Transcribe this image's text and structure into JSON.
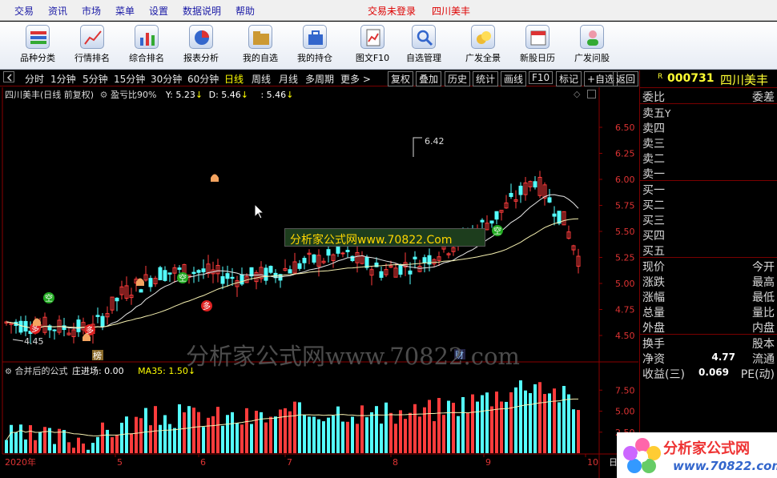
{
  "menu": {
    "items": [
      "交易",
      "资讯",
      "市场",
      "菜单",
      "设置",
      "数据说明",
      "帮助"
    ],
    "status": "交易未登录",
    "stock_name": "四川美丰"
  },
  "toolbar": {
    "buttons": [
      "品种分类",
      "行情排名",
      "综合排名",
      "报表分析",
      "我的自选",
      "我的持仓",
      "图文F10",
      "自选管理",
      "广发全景",
      "新股日历",
      "广发问股"
    ]
  },
  "period_bar": {
    "periods": [
      "分时",
      "1分钟",
      "5分钟",
      "15分钟",
      "30分钟",
      "60分钟",
      "日线",
      "周线",
      "月线",
      "多周期",
      "更多 >"
    ],
    "active": "日线",
    "tools": [
      "复权",
      "叠加",
      "历史",
      "统计",
      "画线",
      "F10",
      "标记",
      "+自选",
      "返回"
    ]
  },
  "main_chart": {
    "title": "四川美丰(日线 前复权)",
    "indicator": "盈亏比90%",
    "y_label": "Y: 5.23",
    "d_label": "D: 5.46",
    "c_label": ": 5.46",
    "high_label": "6.42",
    "low_label": "4.45",
    "price_ticks": [
      "6.50",
      "6.25",
      "6.00",
      "5.75",
      "5.50",
      "5.25",
      "5.00",
      "4.75",
      "4.50"
    ],
    "markers": {
      "buy": "多",
      "sell": "空",
      "rank": "榜",
      "finance": "财"
    },
    "watermark": "分析家公式网www.70822.com",
    "banner": "分析家公式网www.70822.Com"
  },
  "sub_chart": {
    "title": "合并后的公式",
    "indicator": "庄进场: 0.00",
    "ma": "MA35: 1.50",
    "ticks": [
      "7.50",
      "5.00",
      "2.50"
    ]
  },
  "x_axis": {
    "labels": [
      "2020年",
      "5",
      "6",
      "7",
      "8",
      "9",
      "10"
    ],
    "right_label": "日"
  },
  "quote": {
    "code": "000731",
    "name": "四川美丰",
    "r_mark": "R",
    "weibi": "委比",
    "weicha": "委差",
    "sells": [
      "卖五",
      "卖四",
      "卖三",
      "卖二",
      "卖一"
    ],
    "sell5_extra": "Y",
    "buys": [
      "买一",
      "买二",
      "买三",
      "买四",
      "买五"
    ],
    "rows": [
      {
        "l": "现价",
        "r": "今开"
      },
      {
        "l": "涨跌",
        "r": "最高"
      },
      {
        "l": "涨幅",
        "r": "最低"
      },
      {
        "l": "总量",
        "r": "量比"
      },
      {
        "l": "外盘",
        "r": "内盘"
      }
    ],
    "rows2": [
      {
        "l": "换手",
        "m": "",
        "r": "股本"
      },
      {
        "l": "净资",
        "m": "4.77",
        "r": "流通"
      },
      {
        "l": "收益(三)",
        "m": "0.069",
        "r": "PE(动)"
      }
    ]
  },
  "logo": {
    "text": "分析家公式网",
    "url": "www.70822.com"
  }
}
